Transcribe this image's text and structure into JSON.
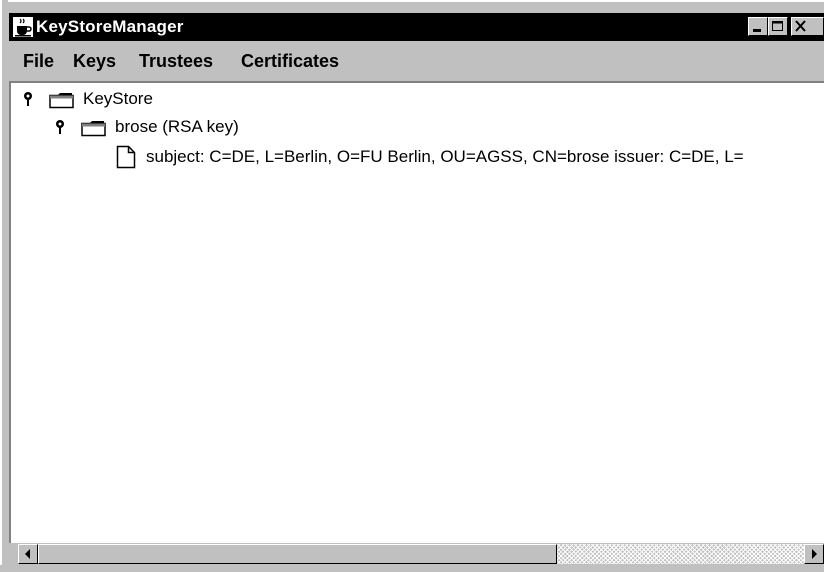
{
  "window": {
    "title": "KeyStoreManager",
    "icons": {
      "app": "java-cup-icon",
      "minimize": "minimize-icon",
      "maximize": "maximize-icon",
      "close": "close-icon"
    }
  },
  "menu": {
    "file": "File",
    "keys": "Keys",
    "trustees": "Trustees",
    "certificates": "Certificates"
  },
  "tree": {
    "root": {
      "label": "KeyStore",
      "expanded": true,
      "icon": "folder-icon"
    },
    "child": {
      "label": "brose (RSA key)",
      "expanded": true,
      "icon": "folder-icon"
    },
    "leaf": {
      "label": "subject: C=DE, L=Berlin, O=FU Berlin, OU=AGSS, CN=brose issuer: C=DE, L=",
      "icon": "document-icon"
    }
  },
  "scrollbar": {
    "position": 0,
    "visible_fraction": 0.68
  }
}
